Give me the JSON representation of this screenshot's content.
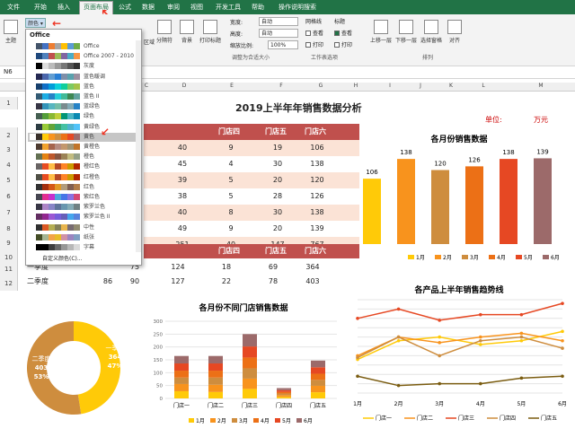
{
  "tabs": [
    "文件",
    "开始",
    "插入",
    "页面布局",
    "公式",
    "数据",
    "审阅",
    "视图",
    "开发工具",
    "帮助",
    "操作说明搜索"
  ],
  "ribbon": {
    "theme": "主题",
    "colors": "颜色",
    "margins": "边距",
    "orientation": "纸张方向",
    "size": "纸张大小",
    "area": "区域",
    "breaks": "分隔符",
    "background": "背景",
    "print_titles": "打印标题",
    "width_label": "宽度:",
    "width_val": "自动",
    "height_label": "高度:",
    "height_val": "自动",
    "scale_label": "缩放比例:",
    "scale_val": "100%",
    "group_scale": "调整为合适大小",
    "gridlines": "网格线",
    "headings": "标题",
    "view1": "查看",
    "view2": "查看",
    "print1": "打印",
    "print2": "打印",
    "group_sheet": "工作表选项",
    "bring_fwd": "上移一层",
    "send_back": "下移一层",
    "sel_pane": "选择窗格",
    "align": "对齐",
    "group_arrange": "排列"
  },
  "namebox": "N6",
  "columns": [
    "A",
    "B",
    "C",
    "D",
    "E",
    "F",
    "G",
    "H",
    "I",
    "J",
    "K",
    "L",
    "M"
  ],
  "dropdown": {
    "header": "Office",
    "items": [
      {
        "label": "Office",
        "colors": [
          "#fff",
          "#44546a",
          "#4472c4",
          "#ed7d31",
          "#a5a5a5",
          "#ffc000",
          "#5b9bd5",
          "#70ad47"
        ]
      },
      {
        "label": "Office 2007 - 2010",
        "colors": [
          "#fff",
          "#1f497d",
          "#4f81bd",
          "#c0504d",
          "#9bbb59",
          "#8064a2",
          "#4bacc6",
          "#f79646"
        ]
      },
      {
        "label": "灰度",
        "colors": [
          "#fff",
          "#000",
          "#ddd",
          "#bbb",
          "#999",
          "#777",
          "#555",
          "#333"
        ]
      },
      {
        "label": "蓝色暖调",
        "colors": [
          "#fff",
          "#242852",
          "#4a66ac",
          "#629dd1",
          "#297fd5",
          "#7f8fa9",
          "#5aa2ae",
          "#9d90a0"
        ]
      },
      {
        "label": "蓝色",
        "colors": [
          "#fff",
          "#17406d",
          "#0f6fc6",
          "#009dd9",
          "#0bd0d9",
          "#10cf9b",
          "#7cca62",
          "#a5c249"
        ]
      },
      {
        "label": "蓝色 II",
        "colors": [
          "#fff",
          "#335b74",
          "#1cade4",
          "#2683c6",
          "#27ced7",
          "#42ba97",
          "#3e8853",
          "#62a39f"
        ]
      },
      {
        "label": "蓝绿色",
        "colors": [
          "#fff",
          "#373545",
          "#3494ba",
          "#58b6c0",
          "#75bda7",
          "#7a8c8e",
          "#84acb6",
          "#2683c6"
        ]
      },
      {
        "label": "绿色",
        "colors": [
          "#fff",
          "#455f51",
          "#549e39",
          "#8ab833",
          "#c0cf3a",
          "#029676",
          "#4ab5c4",
          "#0989b1"
        ]
      },
      {
        "label": "黄绿色",
        "colors": [
          "#fff",
          "#2c3c43",
          "#99cb38",
          "#63a537",
          "#37a76f",
          "#44c1a3",
          "#4eb3cf",
          "#51c3f9"
        ]
      },
      {
        "label": "黄色",
        "colors": [
          "#fff",
          "#39302a",
          "#ffca08",
          "#f8931d",
          "#ce8d3e",
          "#ec7016",
          "#e64823",
          "#9c6a6a"
        ]
      },
      {
        "label": "黄橙色",
        "colors": [
          "#fff",
          "#4e3b30",
          "#f0a22e",
          "#a5644e",
          "#b58b80",
          "#c3986d",
          "#a19574",
          "#c17529"
        ]
      },
      {
        "label": "橙色",
        "colors": [
          "#fff",
          "#637052",
          "#e48312",
          "#bd582c",
          "#865640",
          "#9b8357",
          "#c2bc80",
          "#94a088"
        ]
      },
      {
        "label": "橙红色",
        "colors": [
          "#fff",
          "#696464",
          "#e84c22",
          "#ffbd47",
          "#b64926",
          "#ff8427",
          "#cc9900",
          "#b22600"
        ]
      },
      {
        "label": "红橙色",
        "colors": [
          "#fff",
          "#505046",
          "#e84c22",
          "#ffbd47",
          "#b64926",
          "#ff8427",
          "#cc9900",
          "#b22600"
        ]
      },
      {
        "label": "红色",
        "colors": [
          "#fff",
          "#323232",
          "#a5300f",
          "#d55816",
          "#e19825",
          "#b19c7d",
          "#7f5f52",
          "#b27d49"
        ]
      },
      {
        "label": "紫红色",
        "colors": [
          "#fff",
          "#454551",
          "#e32d91",
          "#c830cc",
          "#4ea6dc",
          "#4775e7",
          "#8971e1",
          "#d54773"
        ]
      },
      {
        "label": "紫罗兰色",
        "colors": [
          "#fff",
          "#373545",
          "#ad84c6",
          "#8784c7",
          "#5d739a",
          "#6997af",
          "#84acb6",
          "#6f8183"
        ]
      },
      {
        "label": "紫罗兰色 II",
        "colors": [
          "#fff",
          "#632e62",
          "#92278f",
          "#9b57d3",
          "#755dd9",
          "#665eb8",
          "#45a5ed",
          "#5982db"
        ]
      },
      {
        "label": "中性",
        "colors": [
          "#fff",
          "#303030",
          "#dc5924",
          "#b5ae53",
          "#848058",
          "#e8b54d",
          "#786c71",
          "#928b70"
        ]
      },
      {
        "label": "纸张",
        "colors": [
          "#fff",
          "#444d26",
          "#a5b592",
          "#f3a447",
          "#e7bc29",
          "#d092a7",
          "#9c85c0",
          "#809ec2"
        ]
      },
      {
        "label": "字幕",
        "colors": [
          "#fff",
          "#000",
          "#000",
          "#3e3e3e",
          "#696969",
          "#969696",
          "#b7b7b7",
          "#d9d9d9"
        ]
      }
    ],
    "custom": "自定义颜色(C)..."
  },
  "title": "2019上半年年销售数据分析",
  "unit_label": "单位:",
  "unit_value": "万元",
  "table": {
    "headers": [
      "门店四",
      "门店五",
      "门店六"
    ],
    "rows": [
      [
        40,
        9,
        19,
        106
      ],
      [
        45,
        4,
        30,
        138
      ],
      [
        39,
        5,
        20,
        120
      ],
      [
        38,
        5,
        28,
        126
      ],
      [
        40,
        8,
        30,
        138
      ],
      [
        49,
        9,
        20,
        139
      ],
      [
        251,
        40,
        147,
        767
      ]
    ],
    "q_headers": [
      "门店四",
      "门店五",
      "门店六"
    ],
    "q_rows": [
      [
        "一季度",
        "",
        75,
        124,
        18,
        69,
        364
      ],
      [
        "二季度",
        86,
        90,
        127,
        22,
        78,
        403
      ]
    ]
  },
  "row_numbers": [
    "1",
    "2",
    "3",
    "4",
    "5",
    "6",
    "7",
    "8",
    "9",
    "10",
    "11",
    "12"
  ],
  "chart_data": [
    {
      "type": "bar",
      "title": "各月份销售数据",
      "categories": [
        "1月",
        "2月",
        "3月",
        "4月",
        "5月",
        "6月"
      ],
      "values": [
        106,
        138,
        120,
        126,
        138,
        139
      ],
      "colors": [
        "#ffca08",
        "#f8931d",
        "#ce8d3e",
        "#ec7016",
        "#e64823",
        "#9c6a6a"
      ]
    },
    {
      "type": "pie",
      "donut": true,
      "slices": [
        {
          "name": "一季度",
          "value": 364,
          "pct": "47%"
        },
        {
          "name": "二季度",
          "value": 403,
          "pct": "53%"
        }
      ],
      "colors": [
        "#ffca08",
        "#ce8d3e"
      ]
    },
    {
      "type": "bar",
      "stacked": true,
      "title": "各月份不同门店销售数据",
      "categories": [
        "门店一",
        "门店二",
        "门店三",
        "门店四",
        "门店五"
      ],
      "ylim": [
        0,
        300
      ],
      "yticks": [
        0,
        50,
        100,
        150,
        200,
        250,
        300
      ],
      "series": [
        {
          "name": "1月",
          "values": [
            28,
            25,
            37,
            6,
            24
          ]
        },
        {
          "name": "2月",
          "values": [
            28,
            28,
            40,
            7,
            25
          ]
        },
        {
          "name": "3月",
          "values": [
            25,
            28,
            40,
            6,
            23
          ]
        },
        {
          "name": "4月",
          "values": [
            27,
            27,
            42,
            6,
            24
          ]
        },
        {
          "name": "5月",
          "values": [
            28,
            28,
            43,
            7,
            25
          ]
        },
        {
          "name": "6月",
          "values": [
            29,
            29,
            48,
            8,
            26
          ]
        }
      ],
      "colors": [
        "#ffca08",
        "#f8931d",
        "#ce8d3e",
        "#ec7016",
        "#e64823",
        "#9c6a6a"
      ]
    },
    {
      "type": "line",
      "title": "各产品上半年销售趋势线",
      "categories": [
        "1月",
        "2月",
        "3月",
        "4月",
        "5月",
        "6月"
      ],
      "ylim": [
        0,
        50
      ],
      "yticks": [
        0,
        5,
        10,
        15,
        20,
        25,
        30,
        35,
        40,
        45,
        50
      ],
      "series": [
        {
          "name": "门店一",
          "values": [
            18,
            28,
            30,
            26,
            28,
            33
          ]
        },
        {
          "name": "门店二",
          "values": [
            20,
            30,
            27,
            30,
            32,
            28
          ]
        },
        {
          "name": "门店三",
          "values": [
            40,
            45,
            39,
            42,
            42,
            48
          ]
        },
        {
          "name": "门店四",
          "values": [
            19,
            30,
            20,
            28,
            30,
            24
          ]
        },
        {
          "name": "门店五",
          "values": [
            9,
            4,
            5,
            5,
            8,
            9
          ]
        }
      ],
      "colors": [
        "#ffca08",
        "#f8931d",
        "#e64823",
        "#ce8d3e",
        "#7a5c10"
      ]
    }
  ]
}
